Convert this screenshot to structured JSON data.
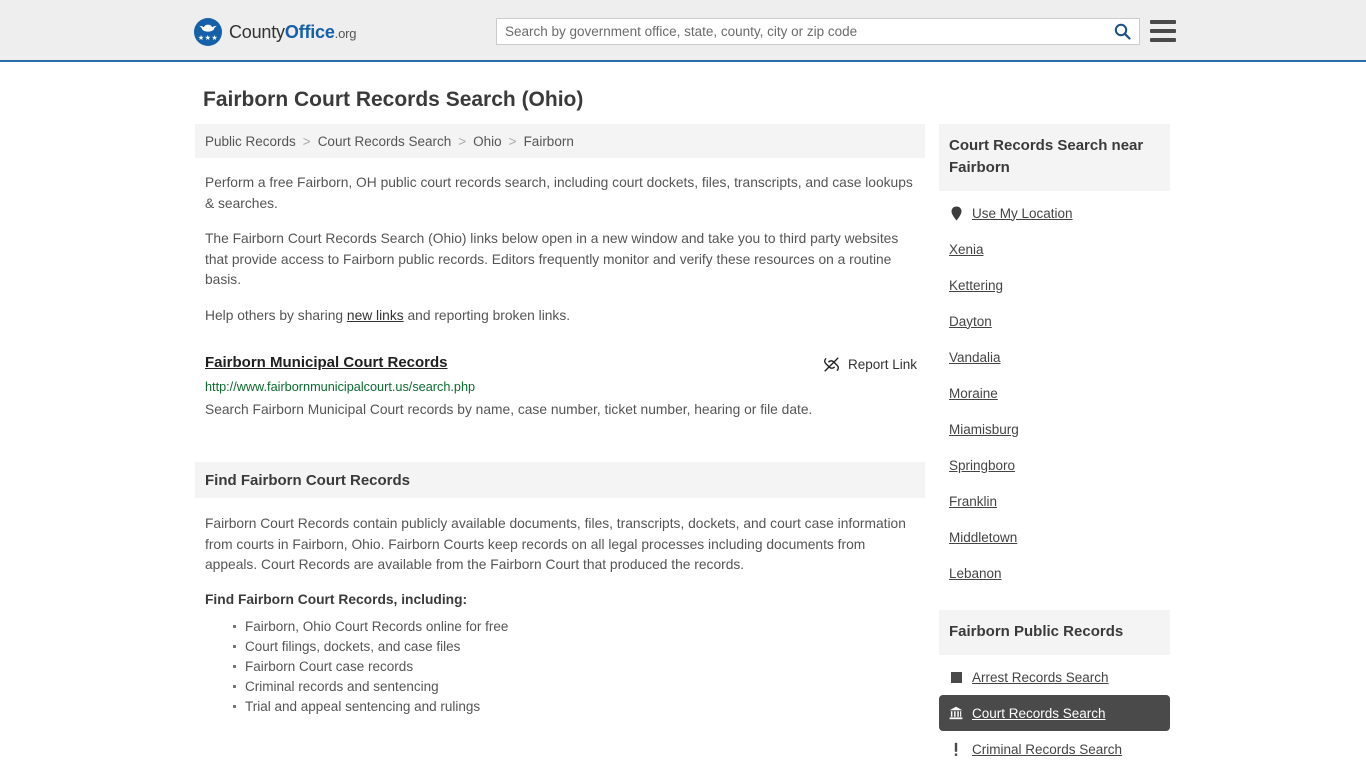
{
  "header": {
    "brand": {
      "county": "County",
      "office": "Office",
      "org": ".org"
    },
    "search": {
      "placeholder": "Search by government office, state, county, city or zip code",
      "value": "",
      "icon": "search-icon"
    },
    "menu_icon": "hamburger-menu-icon"
  },
  "page": {
    "title": "Fairborn Court Records Search (Ohio)"
  },
  "breadcrumb": {
    "separator": ">",
    "items": [
      {
        "label": "Public Records",
        "current": false
      },
      {
        "label": "Court Records Search",
        "current": false
      },
      {
        "label": "Ohio",
        "current": false
      },
      {
        "label": "Fairborn",
        "current": true
      }
    ]
  },
  "intro": {
    "p1": "Perform a free Fairborn, OH public court records search, including court dockets, files, transcripts, and case lookups & searches.",
    "p2": "The Fairborn Court Records Search (Ohio) links below open in a new window and take you to third party websites that provide access to Fairborn public records. Editors frequently monitor and verify these resources on a routine basis.",
    "p3_before": "Help others by sharing ",
    "p3_link": "new links",
    "p3_after": " and reporting broken links."
  },
  "result": {
    "title": "Fairborn Municipal Court Records",
    "url": "http://www.fairbornmunicipalcourt.us/search.php",
    "description": "Search Fairborn Municipal Court records by name, case number, ticket number, hearing or file date.",
    "report_label": "Report Link",
    "report_icon": "broken-link-icon"
  },
  "find_section": {
    "heading": "Find Fairborn Court Records",
    "body": "Fairborn Court Records contain publicly available documents, files, transcripts, dockets, and court case information from courts in Fairborn, Ohio. Fairborn Courts keep records on all legal processes including documents from appeals. Court Records are available from the Fairborn Court that produced the records.",
    "subheading": "Find Fairborn Court Records, including:",
    "items": [
      "Fairborn, Ohio Court Records online for free",
      "Court filings, dockets, and case files",
      "Fairborn Court case records",
      "Criminal records and sentencing",
      "Trial and appeal sentencing and rulings"
    ]
  },
  "sidebar": {
    "nearby": {
      "heading": "Court Records Search near Fairborn",
      "items": [
        {
          "label": "Use My Location",
          "icon": "map-pin-icon"
        },
        {
          "label": "Xenia",
          "icon": ""
        },
        {
          "label": "Kettering",
          "icon": ""
        },
        {
          "label": "Dayton",
          "icon": ""
        },
        {
          "label": "Vandalia",
          "icon": ""
        },
        {
          "label": "Moraine",
          "icon": ""
        },
        {
          "label": "Miamisburg",
          "icon": ""
        },
        {
          "label": "Springboro",
          "icon": ""
        },
        {
          "label": "Franklin",
          "icon": ""
        },
        {
          "label": "Middletown",
          "icon": ""
        },
        {
          "label": "Lebanon",
          "icon": ""
        }
      ]
    },
    "public_records": {
      "heading": "Fairborn Public Records",
      "items": [
        {
          "label": "Arrest Records Search",
          "icon": "square-icon",
          "active": false
        },
        {
          "label": "Court Records Search",
          "icon": "bank-icon",
          "active": true
        },
        {
          "label": "Criminal Records Search",
          "icon": "exclamation-icon",
          "active": false
        }
      ]
    }
  },
  "colors": {
    "header_bg": "#eeeeee",
    "header_border": "#2a6ca8",
    "brand_blue": "#1560a8",
    "panel_bg": "#f4f4f4",
    "url_green": "#0b6b2e",
    "active_bg": "#4a4a4a",
    "text": "#555555"
  }
}
